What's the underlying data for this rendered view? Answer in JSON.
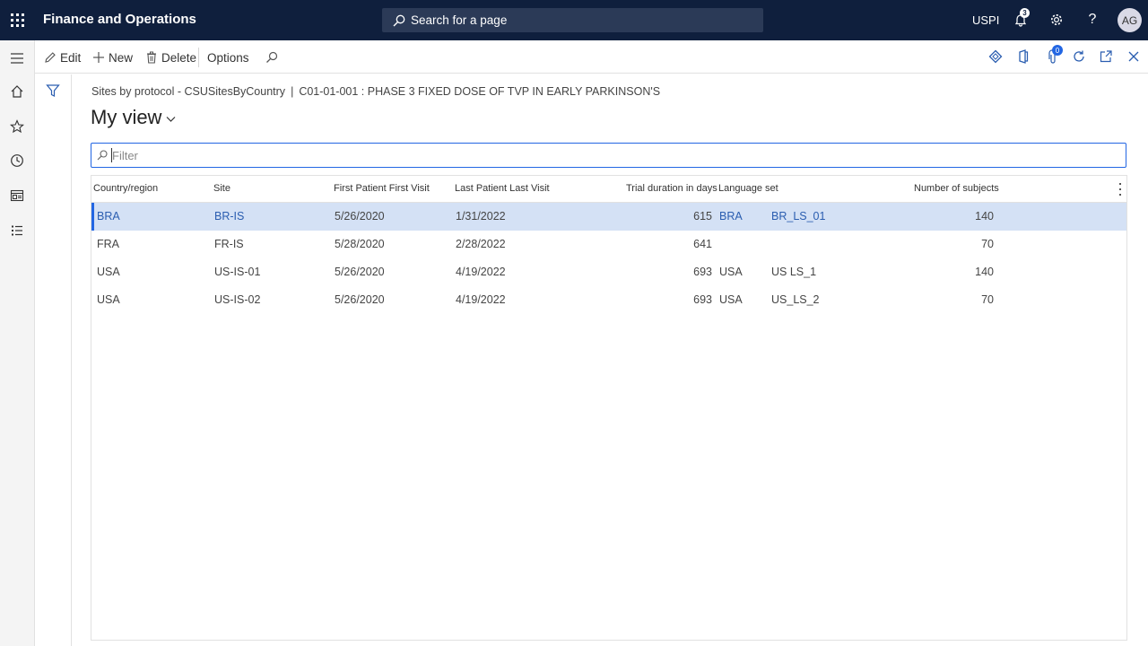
{
  "topbar": {
    "app_title": "Finance and Operations",
    "search_placeholder": "Search for a page",
    "company": "USPI",
    "notification_count": "3",
    "avatar_initials": "AG"
  },
  "actionpane": {
    "edit": "Edit",
    "new": "New",
    "delete": "Delete",
    "options": "Options",
    "attachments_count": "0"
  },
  "page": {
    "breadcrumb_form": "Sites by protocol - CSUSitesByCountry",
    "breadcrumb_separator": "|",
    "breadcrumb_record": "C01-01-001 : PHASE 3 FIXED DOSE OF TVP IN EARLY PARKINSON'S",
    "view_name": "My view",
    "filter_placeholder": "Filter"
  },
  "grid": {
    "columns": [
      "Country/region",
      "Site",
      "First Patient First Visit",
      "Last Patient Last Visit",
      "Trial duration in days",
      "Language set",
      "Number of subjects"
    ],
    "rows": [
      {
        "country": "BRA",
        "site": "BR-IS",
        "first_visit": "5/26/2020",
        "last_visit": "1/31/2022",
        "duration": "615",
        "lang_country": "BRA",
        "lang_set": "BR_LS_01",
        "subjects": "140",
        "selected": true
      },
      {
        "country": "FRA",
        "site": "FR-IS",
        "first_visit": "5/28/2020",
        "last_visit": "2/28/2022",
        "duration": "641",
        "lang_country": "",
        "lang_set": "",
        "subjects": "70",
        "selected": false
      },
      {
        "country": "USA",
        "site": "US-IS-01",
        "first_visit": "5/26/2020",
        "last_visit": "4/19/2022",
        "duration": "693",
        "lang_country": "USA",
        "lang_set": "US LS_1",
        "subjects": "140",
        "selected": false
      },
      {
        "country": "USA",
        "site": "US-IS-02",
        "first_visit": "5/26/2020",
        "last_visit": "4/19/2022",
        "duration": "693",
        "lang_country": "USA",
        "lang_set": "US_LS_2",
        "subjects": "70",
        "selected": false
      }
    ]
  },
  "colors": {
    "topbar": "#0f1f3d",
    "accent": "#2266e3",
    "selected_row": "#d4e1f5"
  },
  "icons": {
    "topbar": [
      "app-launcher-icon",
      "search-icon",
      "bell-icon",
      "gear-icon",
      "help-icon"
    ],
    "leftnav": [
      "hamburger-icon",
      "home-icon",
      "star-icon",
      "clock-icon",
      "workspace-icon",
      "list-icon"
    ],
    "actionpane": [
      "edit-icon",
      "plus-icon",
      "trash-icon",
      "search-icon",
      "diamond-icon",
      "office-icon",
      "attachment-icon",
      "refresh-icon",
      "popout-icon",
      "close-icon"
    ],
    "filterpane": [
      "filter-icon"
    ]
  }
}
